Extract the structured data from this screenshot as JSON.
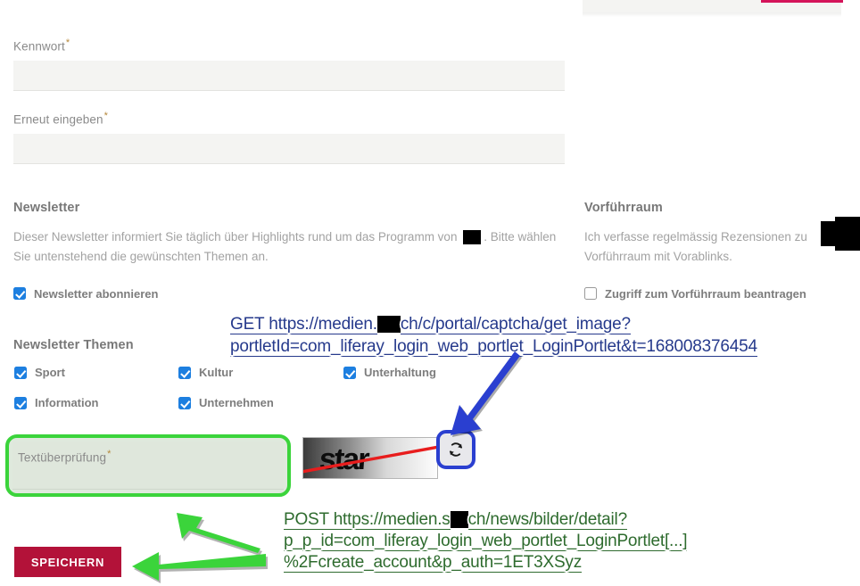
{
  "page": {
    "language": "de",
    "form_name": "liferay-create-account-form"
  },
  "top_partial_field": {
    "name": "cut-off-input-above",
    "underline_color": "#c8114b",
    "background": "#f4f4f2"
  },
  "fields": [
    {
      "id": "kennwort",
      "label": "Kennwort",
      "required": true,
      "value": "",
      "placeholder": ""
    },
    {
      "id": "erneut-eingeben",
      "label": "Erneut eingeben",
      "required": true,
      "value": "",
      "placeholder": ""
    }
  ],
  "newsletter": {
    "title": "Newsletter",
    "description_part1": "Dieser Newsletter informiert Sie täglich über Highlights rund um das Programm von",
    "description_redacted": "",
    "description_part2": ". Bitte wählen Sie untenstehend die gewünschten Themen an.",
    "subscribe": {
      "label": "Newsletter abonnieren",
      "checked": true
    }
  },
  "vorfuehrraum": {
    "title": "Vorführraum",
    "description_part1": "Ich verfasse regelmässig Rezensionen zu",
    "description_redacted": "",
    "description_part2": "Vorführraum mit Vorablinks.",
    "request_access": {
      "label": "Zugriff zum Vorführraum beantragen",
      "checked": false
    }
  },
  "newsletter_themen": {
    "title": "Newsletter Themen",
    "topics": [
      {
        "label": "Sport",
        "checked": true
      },
      {
        "label": "Kultur",
        "checked": true
      },
      {
        "label": "Unterhaltung",
        "checked": true
      },
      {
        "label": "Information",
        "checked": true
      },
      {
        "label": "Unternehmen",
        "checked": true
      }
    ]
  },
  "captcha": {
    "input_label": "Textüberprüfung",
    "input_required": true,
    "input_value": "",
    "image_text": "star",
    "image_strike_color": "#e81d1d",
    "refresh_icon": "refresh-icon",
    "highlight_color": "#3bd43b",
    "refresh_highlight_color": "#2a3fd0"
  },
  "actions": {
    "save_label": "SPEICHERN",
    "save_color": "#b31239"
  },
  "annotations": {
    "get_request": {
      "color": "#263a8c",
      "line1_method": "GET",
      "line1_url_a": "https://medien.",
      "line1_redacted": "",
      "line1_url_b": "ch/c/portal/captcha/get_image?",
      "line2": "portletId=com_liferay_login_web_portlet_LoginPortlet&t=168008376454"
    },
    "post_request": {
      "color": "#2e6b2e",
      "line1_method": "POST",
      "line1_url_a": "https://medien.s",
      "line1_redacted": "",
      "line1_url_b": "ch/news/bilder/detail?",
      "line2": "p_p_id=com_liferay_login_web_portlet_LoginPortlet[...]",
      "line3": "%2Fcreate_account&p_auth=1ET3XSyz"
    },
    "arrows": [
      {
        "name": "blue-arrow-to-refresh",
        "color": "#2a3fd0",
        "direction": "down-left"
      },
      {
        "name": "green-arrow-to-captcha-field",
        "color": "#3bd43b",
        "direction": "up-left"
      },
      {
        "name": "green-arrow-to-save-button",
        "color": "#3bd43b",
        "direction": "left"
      }
    ]
  }
}
